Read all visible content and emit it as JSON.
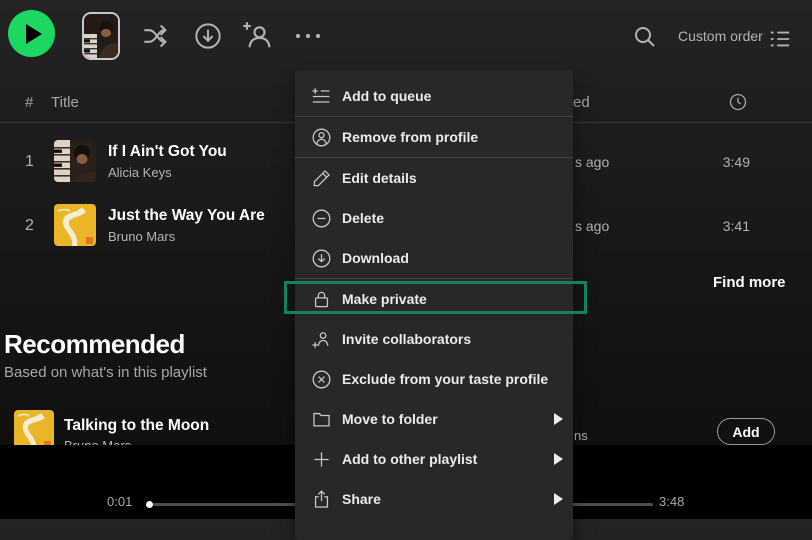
{
  "colors": {
    "accent_green": "#1ed760",
    "highlight_teal": "#12825f",
    "menu_bg": "#282828",
    "page_bg": "#181818",
    "player_bg": "#000000",
    "text_primary": "#ffffff",
    "text_secondary": "#b3b3b3"
  },
  "toolbar": {
    "icons": [
      "play-icon",
      "playlist-cover-thumbnail",
      "shuffle-icon",
      "download-circle-icon",
      "add-collaborator-icon",
      "more-options-icon",
      "search-icon",
      "list-view-icon"
    ],
    "sort_label": "Custom order"
  },
  "table": {
    "header": {
      "index": "#",
      "title": "Title",
      "date_added_partial": "ed",
      "duration_icon": "clock-icon"
    },
    "rows": [
      {
        "index": "1",
        "title": "If I Ain't Got You",
        "artist": "Alicia Keys",
        "art": "alicia",
        "date_added_partial": "s ago",
        "duration": "3:49"
      },
      {
        "index": "2",
        "title": "Just the Way You Are",
        "artist": "Bruno Mars",
        "art": "bruno",
        "date_added_partial": "s ago",
        "duration": "3:41"
      }
    ],
    "find_more_label": "Find more"
  },
  "context_menu": {
    "items": [
      {
        "label": "Add to queue",
        "icon": "add-to-queue-icon",
        "divider_after": true
      },
      {
        "label": "Remove from profile",
        "icon": "user-circle-icon",
        "divider_after": true
      },
      {
        "label": "Edit details",
        "icon": "pencil-icon"
      },
      {
        "label": "Delete",
        "icon": "minus-circle-icon"
      },
      {
        "label": "Download",
        "icon": "download-circle-icon",
        "divider_after": true
      },
      {
        "label": "Make private",
        "icon": "lock-icon",
        "highlighted": true
      },
      {
        "label": "Invite collaborators",
        "icon": "add-user-icon"
      },
      {
        "label": "Exclude from your taste profile",
        "icon": "x-circle-icon"
      },
      {
        "label": "Move to folder",
        "icon": "folder-icon",
        "submenu": true
      },
      {
        "label": "Add to other playlist",
        "icon": "plus-icon",
        "submenu": true
      },
      {
        "label": "Share",
        "icon": "share-icon",
        "submenu": true
      }
    ]
  },
  "recommended": {
    "title": "Recommended",
    "subtitle": "Based on what's in this playlist",
    "row": {
      "title": "Talking to the Moon",
      "artist": "Bruno Mars",
      "art": "bruno",
      "album_partial": "ns",
      "add_label": "Add"
    }
  },
  "player": {
    "elapsed": "0:01",
    "duration": "3:48"
  }
}
